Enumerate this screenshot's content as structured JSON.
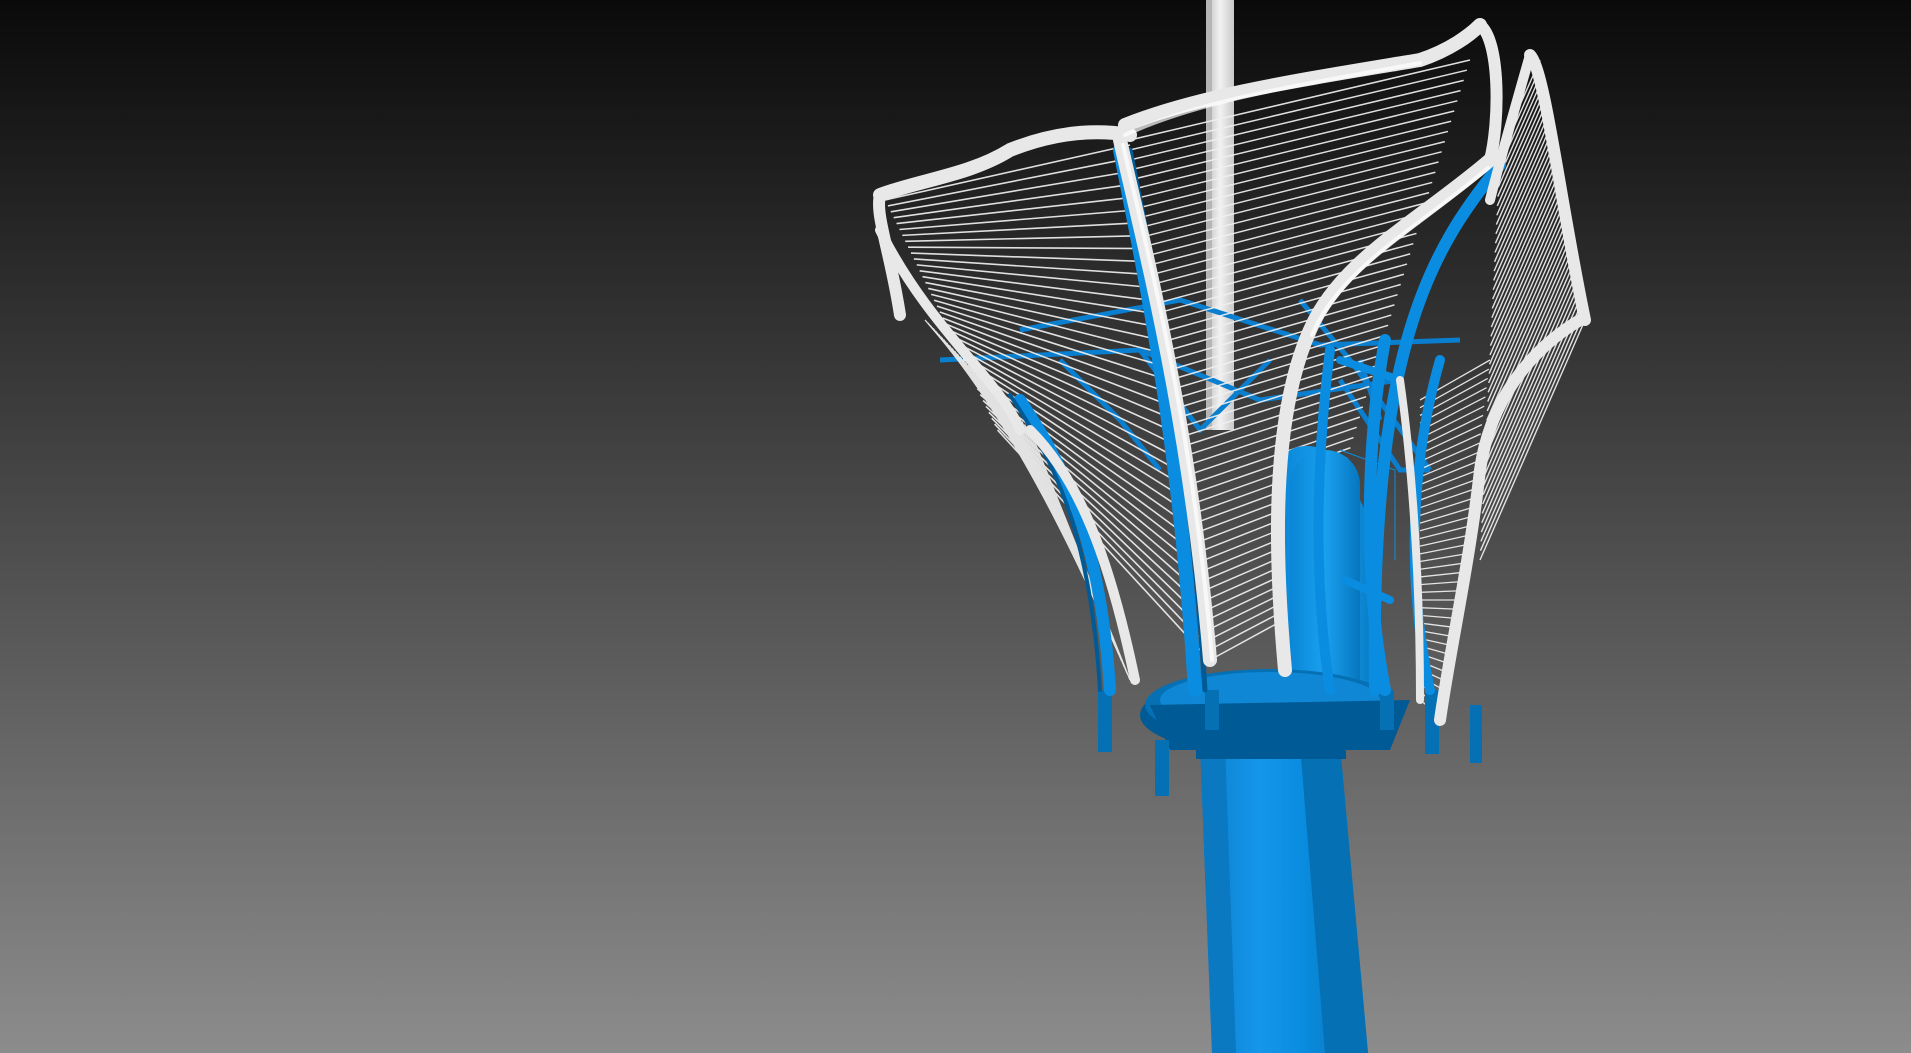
{
  "viewport": {
    "background_top": "#0a0a0a",
    "background_bottom": "#8c8c8c"
  },
  "model": {
    "steel_color": "#0a8de0",
    "steel_shadow": "#005a96",
    "steel_highlight": "#3aa8f0",
    "rail_color": "#e8e8e8",
    "rail_shadow": "#a8a8a8",
    "wire_color": "#f0f0f0"
  }
}
